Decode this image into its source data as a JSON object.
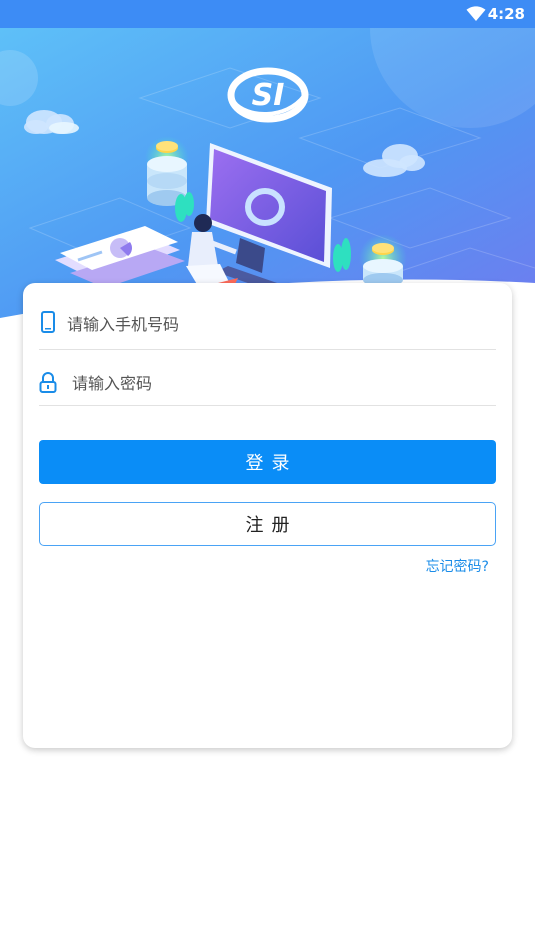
{
  "status_bar": {
    "time": "4:28",
    "icons": [
      "wifi-icon"
    ],
    "color": "#3d8cf5"
  },
  "hero": {
    "logo_text": "SI",
    "logo_icon": "si-logo-icon"
  },
  "login_form": {
    "phone_placeholder": "请输入手机号码",
    "phone_icon": "phone-icon",
    "password_placeholder": "请输入密码",
    "password_icon": "lock-icon",
    "login_label": "登录",
    "register_label": "注册",
    "forgot_label": "忘记密码?"
  },
  "colors": {
    "primary": "#0a8df7",
    "link": "#1a8ce8",
    "register_border": "#4aa3f5"
  }
}
